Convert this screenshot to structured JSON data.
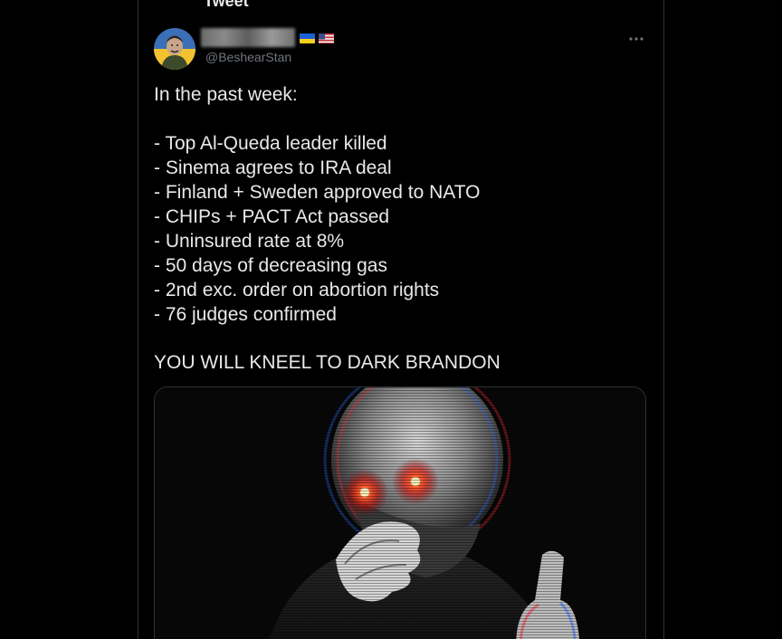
{
  "header": {
    "title_fragment": "Tweet"
  },
  "tweet": {
    "author": {
      "handle": "@BeshearStan",
      "flags": [
        "ukraine-flag-icon",
        "us-flag-icon"
      ]
    },
    "intro": "In the past week:",
    "items": [
      "- Top Al-Queda leader killed",
      "- Sinema agrees to IRA deal",
      "- Finland + Sweden approved to NATO",
      "- CHIPs + PACT Act passed",
      "- Uninsured rate at 8%",
      "- 50 days of decreasing gas",
      "- 2nd exc. order on abortion rights",
      "- 76 judges confirmed"
    ],
    "closing": "YOU WILL KNEEL TO DARK BRANDON"
  },
  "colors": {
    "background": "#000000",
    "text": "#e7e9ea",
    "secondary_text": "#71767b",
    "border": "#2f3336",
    "laser_eyes": "#ff2a1a"
  },
  "icons": {
    "more": "more-options-icon"
  }
}
